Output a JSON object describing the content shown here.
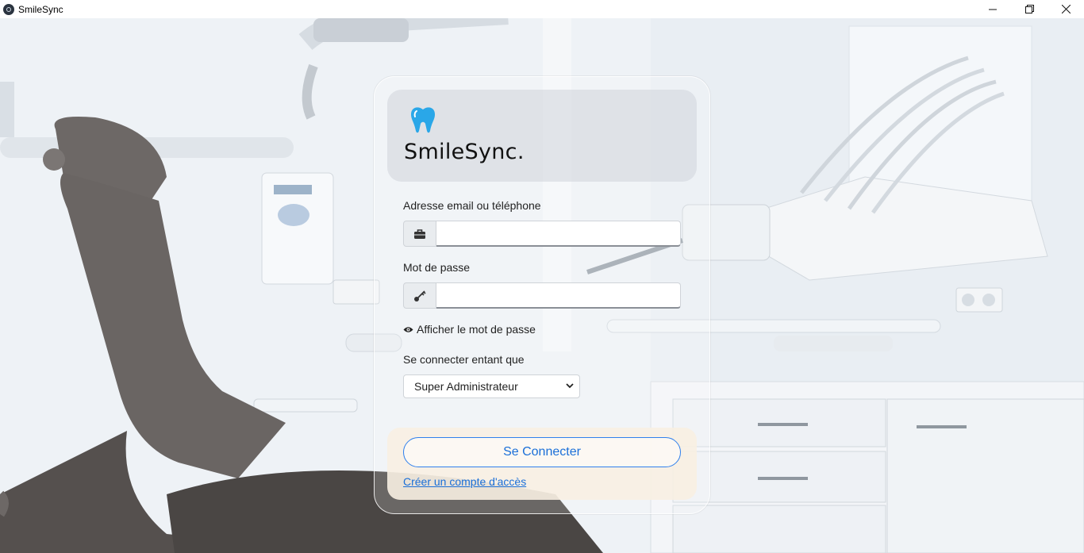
{
  "window": {
    "title": "SmileSync",
    "icons": {
      "app": "app-logo-icon",
      "minimize": "minimize-icon",
      "restore": "restore-icon",
      "close": "close-icon"
    }
  },
  "brand": {
    "name": "SmileSync.",
    "logo_icon": "tooth-icon",
    "logo_color": "#2aa7e8"
  },
  "form": {
    "email_label": "Adresse email ou téléphone",
    "email_value": "",
    "email_icon": "briefcase-icon",
    "password_label": "Mot de passe",
    "password_value": "",
    "password_icon": "key-icon",
    "show_password_label": "Afficher le mot de passe",
    "show_password_icon": "eye-icon",
    "role_label": "Se connecter entant que",
    "role_selected": "Super Administrateur"
  },
  "actions": {
    "connect_label": "Se Connecter",
    "create_account_label": "Créer un compte d'accès"
  },
  "colors": {
    "accent": "#2f80ed",
    "link": "#1a6fd8",
    "action_panel": "#f8f0e2"
  }
}
